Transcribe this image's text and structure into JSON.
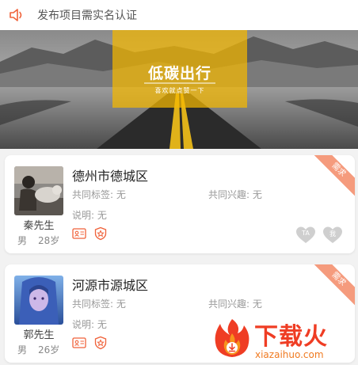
{
  "notice": {
    "text": "发布项目需实名认证"
  },
  "banner": {
    "title": "低碳出行",
    "subtitle": "喜欢就点赞一下"
  },
  "cards": [
    {
      "location": "德州市德城区",
      "common_tags": "共同标签: 无",
      "common_interests": "共同兴趣: 无",
      "description": "说明: 无",
      "name": "秦先生",
      "gender": "男",
      "age": "28岁",
      "ribbon": "需求",
      "heart_ta": "TA",
      "heart_me": "我"
    },
    {
      "location": "河源市源城区",
      "common_tags": "共同标签: 无",
      "common_interests": "共同兴趣: 无",
      "description": "说明: 无",
      "name": "郭先生",
      "gender": "男",
      "age": "26岁",
      "ribbon": "需求"
    }
  ],
  "watermark": {
    "brand": "下载火",
    "domain": "xiazaihuo.com"
  },
  "colors": {
    "accent": "#f0623a",
    "ribbon": "#f59b7d",
    "heart": "#cfcfcf",
    "banner_overlay": "#f5b800"
  },
  "icons": [
    "speaker-icon",
    "id-card-icon",
    "star-shield-icon",
    "heart-icon",
    "fire-logo-icon"
  ]
}
